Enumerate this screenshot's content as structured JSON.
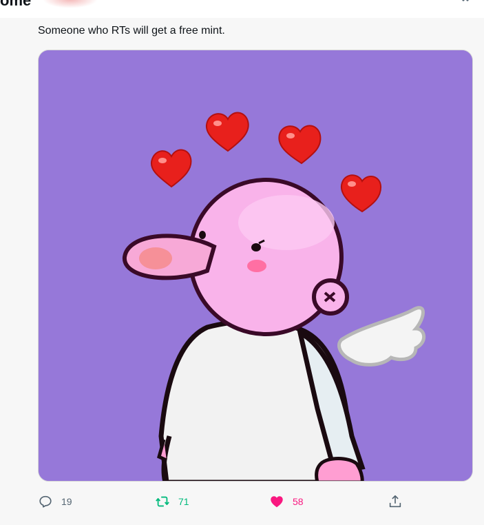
{
  "tweet": {
    "author_name": "ome",
    "text": "Someone who RTs will get a free mint."
  },
  "actions": {
    "reply_count": "19",
    "retweet_count": "71",
    "like_count": "58"
  },
  "icons": {
    "reply": "reply-icon",
    "retweet": "retweet-icon",
    "like": "heart-icon",
    "share": "share-icon",
    "more": "more-icon"
  },
  "colors": {
    "media_background": "#9678d9",
    "retweet_active": "#00ba7c",
    "like_active": "#f91880",
    "muted": "#536471"
  }
}
